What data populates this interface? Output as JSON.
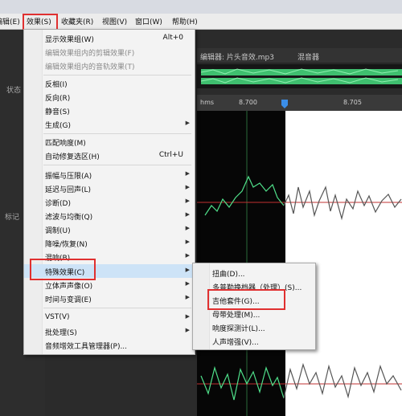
{
  "menubar": {
    "items": [
      "编辑(E)",
      "效果(S)",
      "收藏夹(R)",
      "视图(V)",
      "窗口(W)",
      "帮助(H)"
    ]
  },
  "editor": {
    "tab_label": "编辑器: 片头音效.mp3",
    "mixer_label": "混音器",
    "ruler_unit": "hms",
    "ruler_ticks": [
      "8.700",
      "8.705"
    ]
  },
  "sidepanel": {
    "status_label": "状态",
    "markers_label": "标记"
  },
  "effects_menu": {
    "items": [
      {
        "label": "显示效果组(W)",
        "shortcut": "Alt+0",
        "enabled": true,
        "submenu": false
      },
      {
        "label": "编辑效果组内的剪辑效果(F)",
        "shortcut": "",
        "enabled": false,
        "submenu": false
      },
      {
        "label": "编辑效果组内的音轨效果(T)",
        "shortcut": "",
        "enabled": false,
        "submenu": false
      },
      {
        "label": "反相(I)",
        "shortcut": "",
        "enabled": true,
        "submenu": false
      },
      {
        "label": "反向(R)",
        "shortcut": "",
        "enabled": true,
        "submenu": false
      },
      {
        "label": "静音(S)",
        "shortcut": "",
        "enabled": true,
        "submenu": false
      },
      {
        "label": "生成(G)",
        "shortcut": "",
        "enabled": true,
        "submenu": true
      },
      {
        "label": "匹配响度(M)",
        "shortcut": "",
        "enabled": true,
        "submenu": false
      },
      {
        "label": "自动修复选区(H)",
        "shortcut": "Ctrl+U",
        "enabled": true,
        "submenu": false
      },
      {
        "label": "振幅与压限(A)",
        "shortcut": "",
        "enabled": true,
        "submenu": true
      },
      {
        "label": "延迟与回声(L)",
        "shortcut": "",
        "enabled": true,
        "submenu": true
      },
      {
        "label": "诊断(D)",
        "shortcut": "",
        "enabled": true,
        "submenu": true
      },
      {
        "label": "滤波与均衡(Q)",
        "shortcut": "",
        "enabled": true,
        "submenu": true
      },
      {
        "label": "调制(U)",
        "shortcut": "",
        "enabled": true,
        "submenu": true
      },
      {
        "label": "降噪/恢复(N)",
        "shortcut": "",
        "enabled": true,
        "submenu": true
      },
      {
        "label": "混响(B)",
        "shortcut": "",
        "enabled": true,
        "submenu": true
      },
      {
        "label": "特殊效果(C)",
        "shortcut": "",
        "enabled": true,
        "submenu": true
      },
      {
        "label": "立体声声像(O)",
        "shortcut": "",
        "enabled": true,
        "submenu": true
      },
      {
        "label": "时间与变调(E)",
        "shortcut": "",
        "enabled": true,
        "submenu": true
      },
      {
        "label": "VST(V)",
        "shortcut": "",
        "enabled": true,
        "submenu": true
      },
      {
        "label": "批处理(S)",
        "shortcut": "",
        "enabled": true,
        "submenu": true
      },
      {
        "label": "音频增效工具管理器(P)...",
        "shortcut": "",
        "enabled": true,
        "submenu": false
      }
    ]
  },
  "special_effects_submenu": {
    "items": [
      "扭曲(D)...",
      "多普勒换档器（处理）(S)...",
      "吉他套件(G)...",
      "母带处理(M)...",
      "响度探测计(L)...",
      "人声增强(V)..."
    ]
  },
  "colors": {
    "highlight_box": "#e03030",
    "waveform": "#4fe08a",
    "waveform_selected": "#555555",
    "playhead": "#3b8ee8"
  }
}
